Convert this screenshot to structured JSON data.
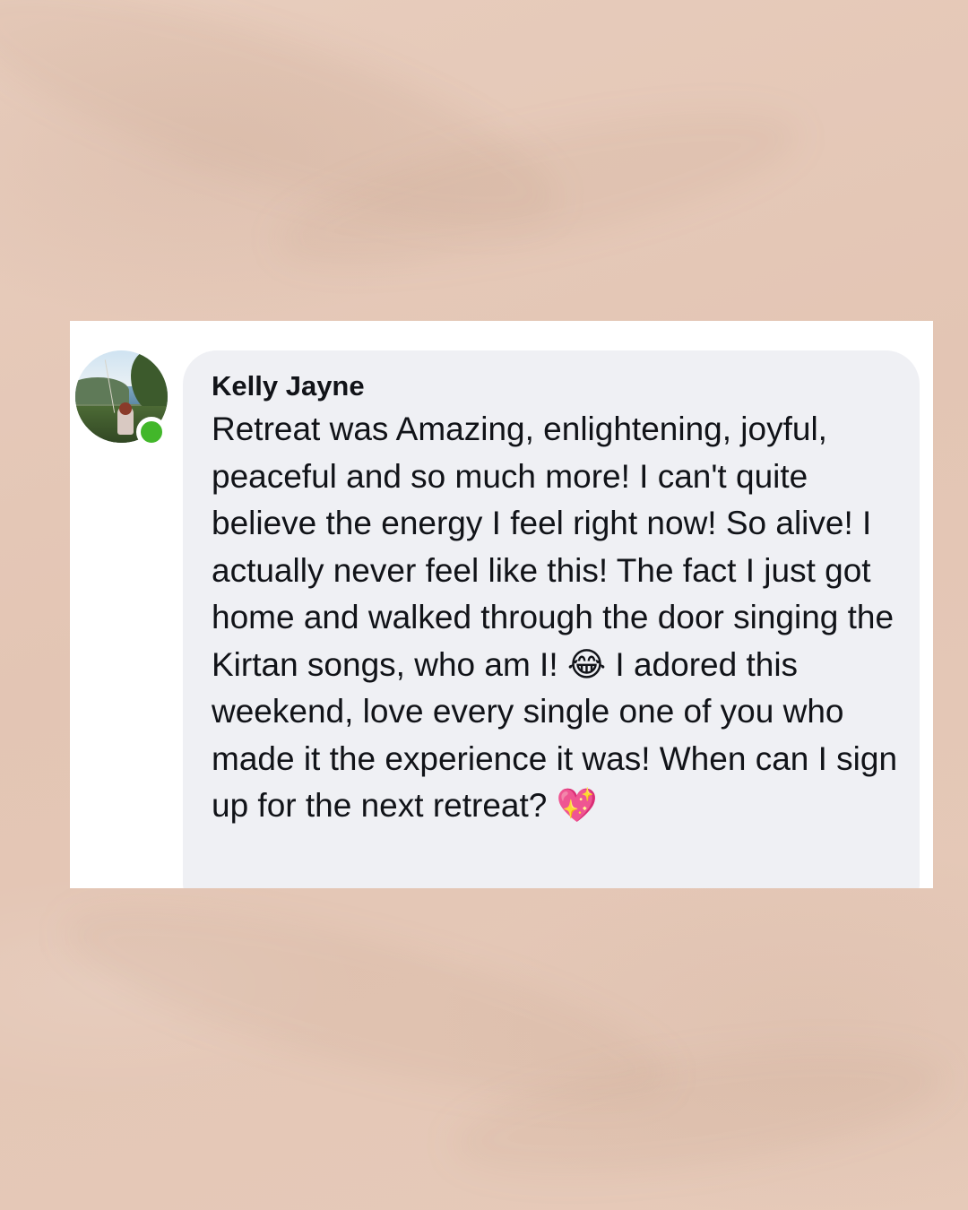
{
  "comment": {
    "author": "Kelly Jayne",
    "text_part1": "Retreat was Amazing, enlightening, joyful, peaceful and so much more! I can't quite believe the energy I feel right now! So alive! I actually never feel like this! The fact I just got home and walked through the door singing the Kirtan songs, who am I!",
    "emoji_1": "😂",
    "text_part2": "I adored this weekend, love every single one of you who made it the experience it was! When can I sign up for the next retreat?",
    "emoji_2": "💖",
    "author_online": true
  },
  "colors": {
    "background": "#e5c8b8",
    "card": "#ffffff",
    "bubble": "#eff0f4",
    "text": "#111318",
    "online_indicator": "#42b72a"
  }
}
